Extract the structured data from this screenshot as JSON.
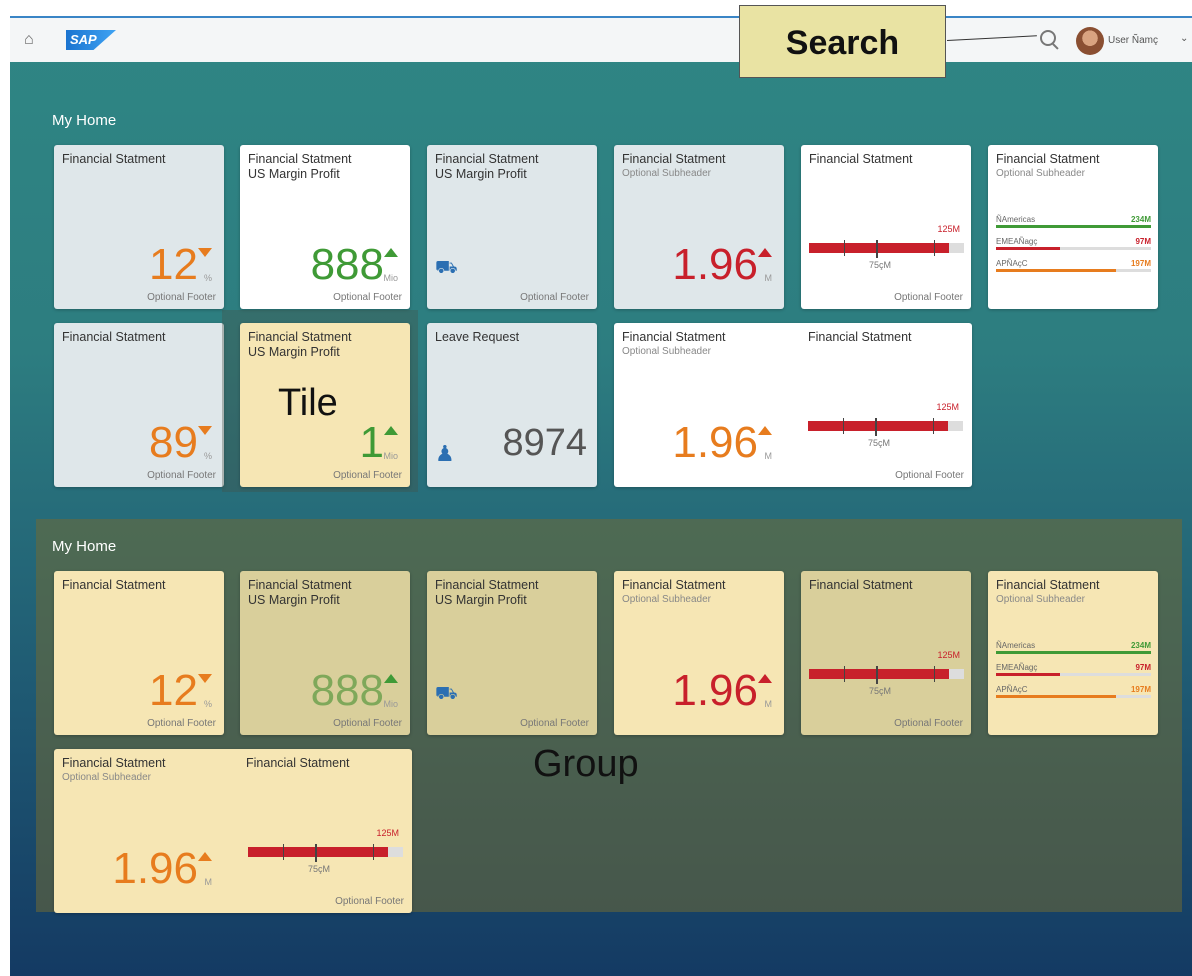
{
  "header": {
    "logo": "SAP",
    "search_label": "Search",
    "user_name": "User Ñamç",
    "home_icon": "home-icon",
    "search_icon": "search-icon"
  },
  "groups": [
    {
      "title": "My Home",
      "tiles": [
        {
          "header": "Financial Statment",
          "sub": "",
          "value": "12",
          "unit": "%",
          "indicator": "down",
          "footer": "Optional Footer"
        },
        {
          "header": "Financial Statment",
          "sub": "US Margin Profit",
          "value": "888",
          "unit": "Mio",
          "indicator": "up",
          "footer": "Optional Footer"
        },
        {
          "header": "Financial Statment",
          "sub": "US Margin Profit",
          "footer": "Optional Footer"
        },
        {
          "header": "Financial Statment",
          "sub": "Optional Subheader",
          "value": "1.96",
          "unit": "M",
          "indicator": "up",
          "footer": ""
        },
        {
          "header": "Financial Statment",
          "bar_top": "125M",
          "bar_bottom": "75çM",
          "footer": "Optional Footer"
        },
        {
          "header": "Financial Statment",
          "sub": "Optional Subheader",
          "rows": [
            {
              "label": "ÑAmericas",
              "value": "234M"
            },
            {
              "label": "EMEAÑagç",
              "value": "97M"
            },
            {
              "label": "APÑAçC",
              "value": "197M"
            }
          ]
        }
      ],
      "tiles2": [
        {
          "header": "Financial Statment",
          "value": "89",
          "unit": "%",
          "indicator": "down",
          "footer": "Optional Footer"
        },
        {
          "header": "Financial Statment",
          "sub": "US Margin Profit",
          "value": "1",
          "unit": "Mio",
          "indicator": "up",
          "footer": "Optional Footer"
        },
        {
          "header": "Leave Request",
          "value": "8974"
        },
        {
          "header": "Financial Statment",
          "sub": "Optional Subheader",
          "header2": "Financial Statment",
          "value": "1.96",
          "unit": "M",
          "indicator": "up",
          "bar_top": "125M",
          "bar_bottom": "75çM",
          "footer": "Optional Footer"
        }
      ]
    },
    {
      "title": "My Home",
      "tiles": [
        {
          "header": "Financial Statment",
          "value": "12",
          "unit": "%",
          "footer": "Optional Footer"
        },
        {
          "header": "Financial Statment",
          "sub": "US Margin Profit",
          "value": "888",
          "unit": "Mio",
          "footer": "Optional Footer"
        },
        {
          "header": "Financial Statment",
          "sub": "US Margin Profit",
          "footer": "Optional Footer"
        },
        {
          "header": "Financial Statment",
          "sub": "Optional Subheader",
          "value": "1.96",
          "unit": "M"
        },
        {
          "header": "Financial Statment",
          "bar_top": "125M",
          "bar_bottom": "75çM",
          "footer": "Optional Footer"
        },
        {
          "header": "Financial Statment",
          "sub": "Optional Subheader",
          "rows": [
            {
              "label": "ÑAmericas",
              "value": "234M"
            },
            {
              "label": "EMEAÑagç",
              "value": "97M"
            },
            {
              "label": "APÑAçC",
              "value": "197M"
            }
          ]
        }
      ],
      "tiles2": [
        {
          "header": "Financial Statment",
          "sub": "Optional Subheader",
          "header2": "Financial Statment",
          "value": "1.96",
          "unit": "M",
          "bar_top": "125M",
          "bar_bottom": "75çM",
          "footer": "Optional Footer"
        }
      ]
    }
  ],
  "annotations": {
    "tile": "Tile",
    "group": "Group"
  }
}
